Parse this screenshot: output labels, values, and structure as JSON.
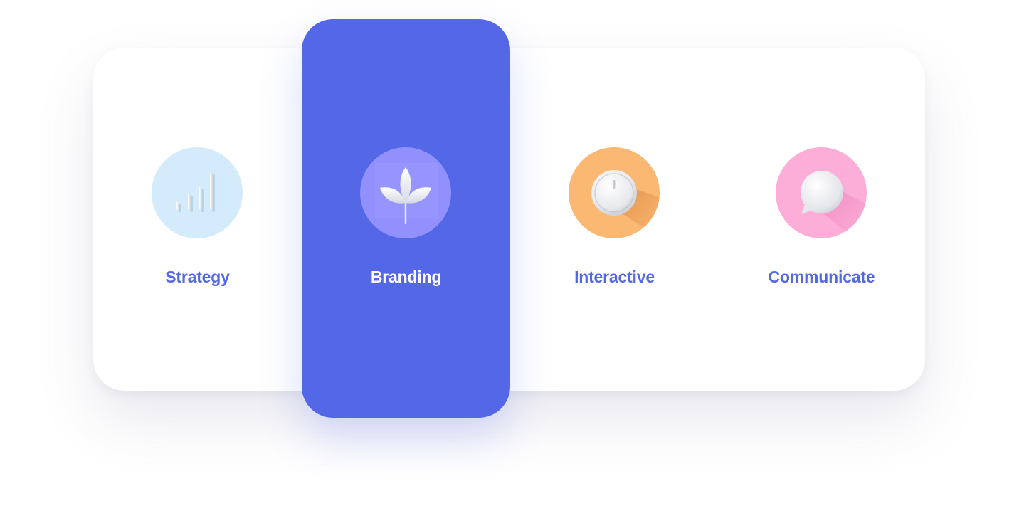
{
  "services": {
    "strategy": {
      "label": "Strategy",
      "icon": "bar-chart-icon",
      "circle_color": "#d3ebfb",
      "label_color": "#5468e7"
    },
    "branding": {
      "label": "Branding",
      "icon": "leaf-icon",
      "circle_color": "#9190fd",
      "label_color": "#ffffff",
      "active": true
    },
    "interactive": {
      "label": "Interactive",
      "icon": "knob-icon",
      "circle_color": "#fbb873",
      "label_color": "#5468e7"
    },
    "communicate": {
      "label": "Communicate",
      "icon": "chat-bubble-icon",
      "circle_color": "#fdaed8",
      "label_color": "#5468e7"
    }
  },
  "accent_color": "#5468e7"
}
